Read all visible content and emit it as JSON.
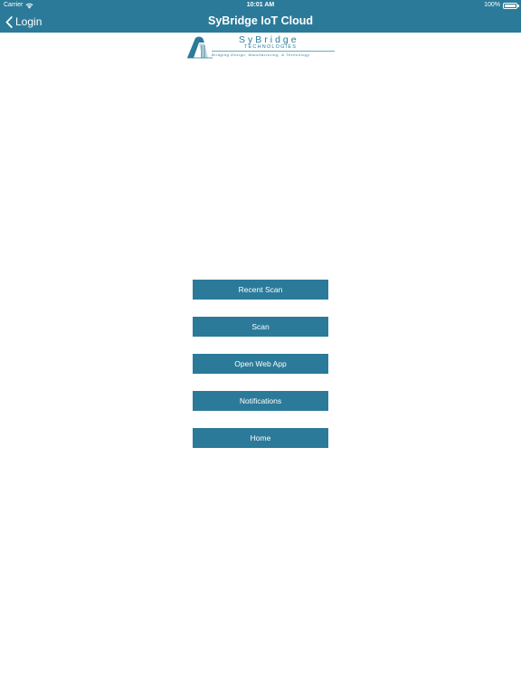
{
  "status_bar": {
    "carrier": "Carrier",
    "time": "10:01 AM",
    "battery": "100%"
  },
  "nav": {
    "back_label": "Login",
    "title": "SyBridge IoT Cloud"
  },
  "logo": {
    "name": "SyBridge",
    "subtitle": "TECHNOLOGIES",
    "tagline": "Bridging Design, Manufacturing, & Technology"
  },
  "menu": {
    "items": [
      {
        "label": "Recent Scan"
      },
      {
        "label": "Scan"
      },
      {
        "label": "Open Web App"
      },
      {
        "label": "Notifications"
      },
      {
        "label": "Home"
      }
    ]
  },
  "colors": {
    "brand": "#2b7a99",
    "background": "#ffffff"
  },
  "icons": [
    "wifi-icon",
    "battery-icon",
    "chevron-left-icon",
    "sybridge-logo-mark"
  ]
}
